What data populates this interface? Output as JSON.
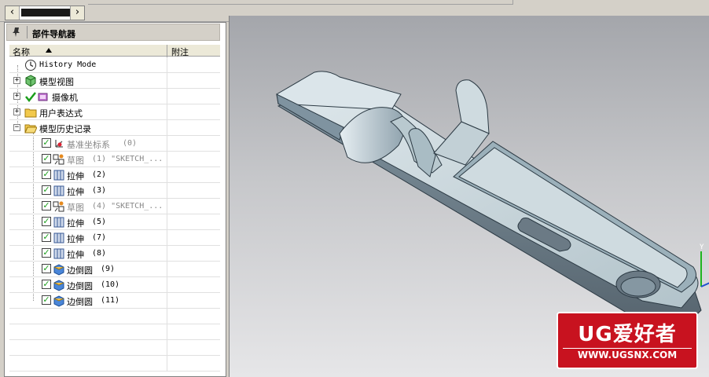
{
  "nav_panel": {
    "title": "部件导航器",
    "columns": {
      "name": "名称",
      "note": "附注"
    },
    "items": [
      {
        "label": "History Mode",
        "mono": true,
        "icon": "clock-icon"
      },
      {
        "label": "模型视图",
        "icon": "model-view-icon"
      },
      {
        "label": "摄像机",
        "icon": "camera-icon"
      },
      {
        "label": "用户表达式",
        "icon": "folder-icon"
      },
      {
        "label": "模型历史记录",
        "icon": "folder-open-icon"
      },
      {
        "label": "基准坐标系",
        "suffix": "(0)",
        "icon": "datum-csys-icon"
      },
      {
        "label": "草图",
        "suffix": "(1) \"SKETCH_...",
        "icon": "sketch-icon"
      },
      {
        "label": "拉伸",
        "suffix": "(2)",
        "icon": "extrude-icon"
      },
      {
        "label": "拉伸",
        "suffix": "(3)",
        "icon": "extrude-icon"
      },
      {
        "label": "草图",
        "suffix": "(4) \"SKETCH_...",
        "icon": "sketch-icon"
      },
      {
        "label": "拉伸",
        "suffix": "(5)",
        "icon": "extrude-icon"
      },
      {
        "label": "拉伸",
        "suffix": "(7)",
        "icon": "extrude-icon"
      },
      {
        "label": "拉伸",
        "suffix": "(8)",
        "icon": "extrude-icon"
      },
      {
        "label": "边倒圆",
        "suffix": "(9)",
        "icon": "edge-blend-icon"
      },
      {
        "label": "边倒圆",
        "suffix": "(10)",
        "icon": "edge-blend-icon"
      },
      {
        "label": "边倒圆",
        "suffix": "(11)",
        "icon": "edge-blend-icon"
      }
    ]
  },
  "viewport": {
    "axis_y": "Y"
  },
  "watermark": {
    "brand": "UG爱好者",
    "url": "WWW.UGSNX.COM"
  },
  "colors": {
    "part_face": "#b9c9cf",
    "part_shadow": "#5f6e78",
    "check_green": "#1b9e1b",
    "watermark_red": "#c8121f"
  }
}
